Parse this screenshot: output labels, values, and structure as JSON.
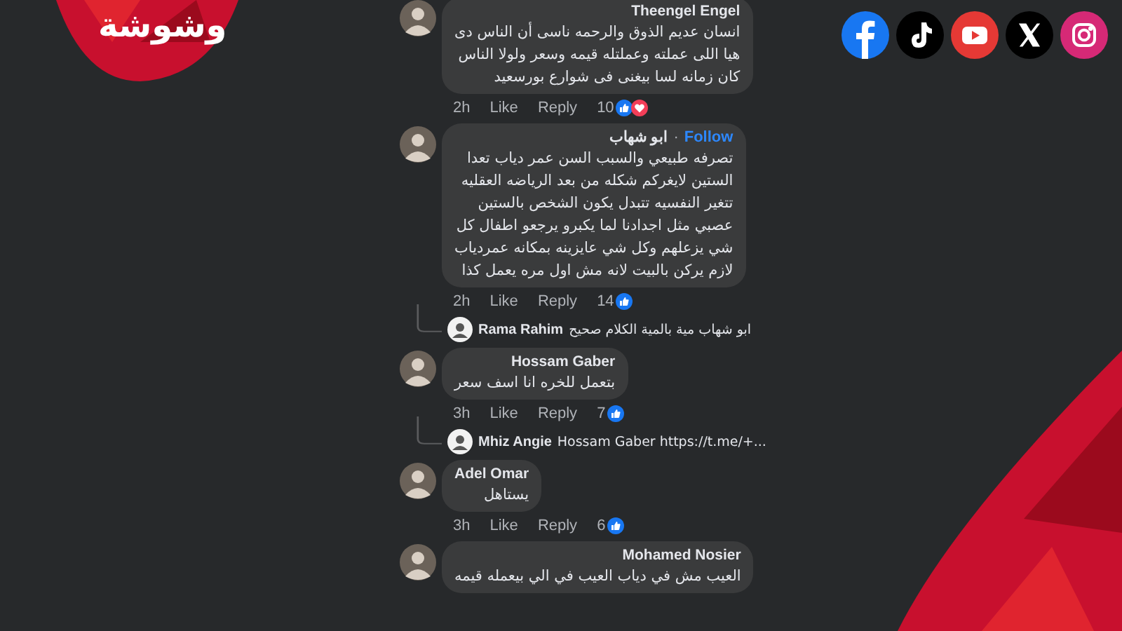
{
  "brand": {
    "logo": "وشوشة"
  },
  "social": [
    {
      "kind": "facebook"
    },
    {
      "kind": "tiktok"
    },
    {
      "kind": "youtube"
    },
    {
      "kind": "x"
    },
    {
      "kind": "instagram"
    }
  ],
  "comments": [
    {
      "author": "Theengel Engel",
      "lines": [
        "انسان عديم الذوق والرحمه ناسى أن الناس دى",
        "هيا اللى عملته وعملتله قيمه وسعر ولولا الناس",
        "كان زمانه لسا بيغنى فى شوارع بورسعيد"
      ],
      "time": "2h",
      "like": "Like",
      "reply": "Reply",
      "count": "10",
      "reactions": [
        {
          "kind": "like"
        },
        {
          "kind": "love"
        }
      ]
    },
    {
      "author": "ابو شهاب",
      "separator": "·",
      "follow_label": "Follow",
      "lines": [
        "تصرفه طبيعي والسبب السن عمر دياب تعدا",
        "الستين لايغركم شكله من بعد الرياضه العقليه",
        "تتغير النفسيه تتبدل يكون الشخص بالستين",
        "عصبي مثل اجدادنا لما يكبرو يرجعو اطفال كل",
        "شي يزعلهم وكل شي عايزينه بمكانه عمردياب",
        "لازم يركن بالبيت لانه مش اول مره يعمل كذا"
      ],
      "time": "2h",
      "like": "Like",
      "reply": "Reply",
      "count": "14",
      "reactions": [
        {
          "kind": "like"
        }
      ],
      "replies": [
        {
          "author": "Rama Rahim",
          "text": "ابو شهاب مية بالمية الكلام صحيح"
        }
      ]
    },
    {
      "author": "Hossam Gaber",
      "lines": [
        "بتعمل للخره انا اسف سعر"
      ],
      "time": "3h",
      "like": "Like",
      "reply": "Reply",
      "count": "7",
      "reactions": [
        {
          "kind": "like"
        }
      ],
      "replies": [
        {
          "author": "Mhiz Angie",
          "text": "Hossam Gaber https://t.me/+..."
        }
      ]
    },
    {
      "author": "Adel Omar",
      "lines": [
        "يستاهل"
      ],
      "time": "3h",
      "like": "Like",
      "reply": "Reply",
      "count": "6",
      "reactions": [
        {
          "kind": "like"
        }
      ]
    },
    {
      "author": "Mohamed Nosier",
      "lines": [
        "العيب مش في دياب العيب في الي بيعمله قيمه"
      ]
    }
  ]
}
